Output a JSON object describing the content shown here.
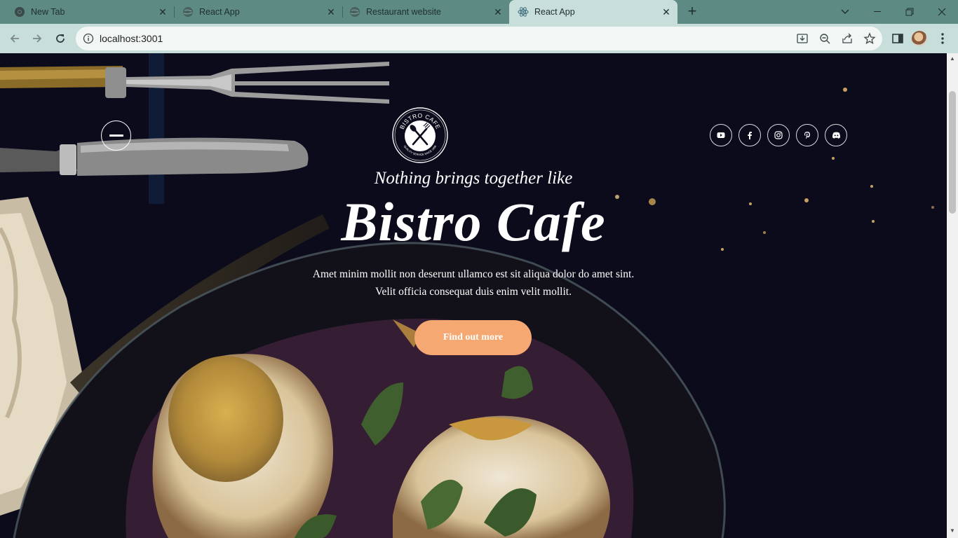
{
  "browser": {
    "tabs": [
      {
        "title": "New Tab",
        "active": false
      },
      {
        "title": "React App",
        "active": false
      },
      {
        "title": "Restaurant website",
        "active": false
      },
      {
        "title": "React App",
        "active": true
      }
    ],
    "address": "localhost:3001",
    "colors": {
      "tab_strip": "#5d8a83",
      "toolbar": "#c7dedb"
    }
  },
  "hero": {
    "tagline": "Nothing brings together like",
    "brand": "Bistro Cafe",
    "description_line1": "Amet minim mollit non deserunt ullamco est sit aliqua dolor do amet sint.",
    "description_line2": "Velit officia consequat duis enim velit mollit.",
    "cta_label": "Find out more",
    "logo": {
      "top_text": "BISTRO CAFE",
      "bottom_text": "QUALITY SERVICE SINCE 1998"
    },
    "colors": {
      "cta": "#f5a872",
      "background": "#0b0b1c",
      "text": "#ffffff"
    }
  },
  "socials": [
    {
      "icon": "youtube-icon"
    },
    {
      "icon": "facebook-icon"
    },
    {
      "icon": "instagram-icon"
    },
    {
      "icon": "pinterest-icon"
    },
    {
      "icon": "discord-icon"
    }
  ]
}
